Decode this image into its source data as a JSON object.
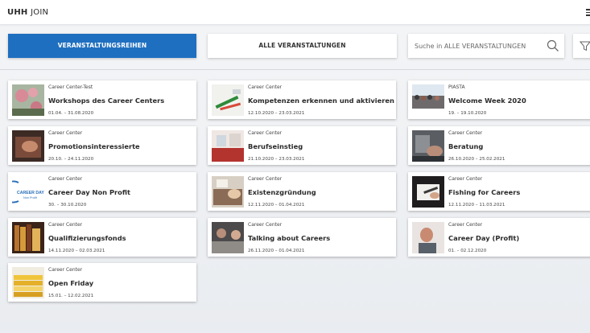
{
  "header": {
    "brand_bold": "UHH",
    "brand_light": "JOIN"
  },
  "toolbar": {
    "series_label": "VERANSTALTUNGSREIHEN",
    "all_label": "ALLE VERANSTALTUNGEN",
    "search_placeholder": "Suche in ALLE VERANSTALTUNGEN"
  },
  "cards": [
    {
      "org": "Career Center-Test",
      "title": "Workshops des Career Centers",
      "date": "01.04. – 31.08.2020",
      "thumb_icon": "flowers-photo"
    },
    {
      "org": "Career Center",
      "title": "Kompetenzen erkennen und aktivieren",
      "date": "12.10.2020 – 23.03.2021",
      "thumb_icon": "markers-photo"
    },
    {
      "org": "PIASTA",
      "title": "Welcome Week 2020",
      "date": "19. – 19.10.2020",
      "thumb_icon": "crowd-photo"
    },
    {
      "org": "Career Center",
      "title": "Promotionsinteressierte",
      "date": "20.10. – 24.11.2020",
      "thumb_icon": "hand-photo"
    },
    {
      "org": "Career Center",
      "title": "Berufseinstieg",
      "date": "21.10.2020 – 23.03.2021",
      "thumb_icon": "office-photo"
    },
    {
      "org": "Career Center",
      "title": "Beratung",
      "date": "26.10.2020 – 25.02.2021",
      "thumb_icon": "consult-photo"
    },
    {
      "org": "Career Center",
      "title": "Career Day Non Profit",
      "date": "30. – 30.10.2020",
      "thumb_icon": "career-day-logo",
      "logo_line1": "CAREER DAY",
      "logo_line2": "Non Profit"
    },
    {
      "org": "Career Center",
      "title": "Existenzgründung",
      "date": "12.11.2020 – 01.04.2021",
      "thumb_icon": "desk-photo"
    },
    {
      "org": "Career Center",
      "title": "Fishing for Careers",
      "date": "12.11.2020 – 11.03.2021",
      "thumb_icon": "writing-photo"
    },
    {
      "org": "Career Center",
      "title": "Qualifizierungsfonds",
      "date": "14.11.2020 – 02.03.2021",
      "thumb_icon": "books-photo"
    },
    {
      "org": "Career Center",
      "title": "Talking about Careers",
      "date": "26.11.2020 – 01.04.2021",
      "thumb_icon": "meeting-photo"
    },
    {
      "org": "Career Center",
      "title": "Career Day (Profit)",
      "date": "01. – 02.12.2020",
      "thumb_icon": "person-photo"
    },
    {
      "org": "Career Center",
      "title": "Open Friday",
      "date": "15.01. – 12.02.2021",
      "thumb_icon": "folders-photo"
    }
  ],
  "colors": {
    "accent": "#1f6fc0",
    "background": "#eceef1"
  }
}
